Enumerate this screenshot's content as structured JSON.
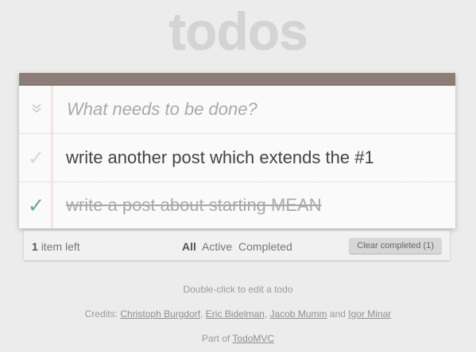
{
  "header": {
    "title": "todos"
  },
  "new_todo": {
    "placeholder": "What needs to be done?",
    "toggle_all_icon": "double-chevron-down-icon"
  },
  "todos": [
    {
      "text": "write another post which extends the #1",
      "completed": false,
      "check_icon": "checkmark-icon"
    },
    {
      "text": "write a post about starting MEAN",
      "completed": true,
      "check_icon": "checkmark-icon"
    }
  ],
  "footer": {
    "count": "1",
    "count_suffix": "item left",
    "filters": [
      "All",
      "Active",
      "Completed"
    ],
    "selected_filter": "All",
    "clear_label": "Clear completed (1)"
  },
  "info": {
    "hint": "Double-click to edit a todo",
    "credits_prefix": "Credits:",
    "credits": [
      "Christoph Burgdorf",
      "Eric Bidelman",
      "Jacob Mumm",
      "Igor Minar"
    ],
    "credits_sep": ",",
    "credits_and": "and",
    "part_of_prefix": "Part of",
    "part_of_link": "TodoMVC"
  },
  "colors": {
    "topbar": "#8d7d77",
    "check_done": "#73a89e",
    "background": "#ececec"
  }
}
